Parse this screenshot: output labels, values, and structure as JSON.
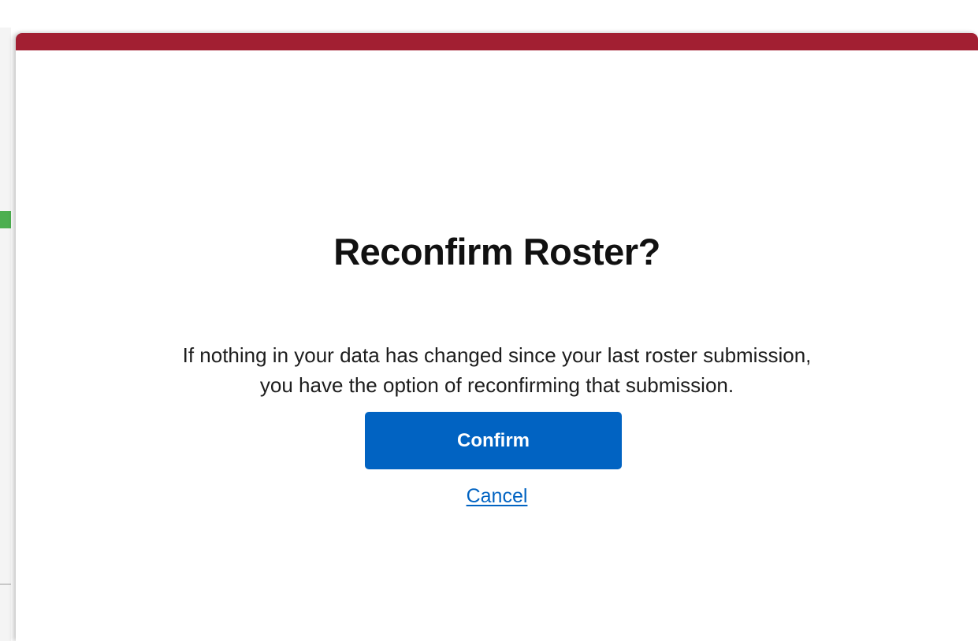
{
  "colors": {
    "modal_top_bar": "#a21f32",
    "primary_button": "#0163c2",
    "link": "#0163c2",
    "background_accent": "#4caf50"
  },
  "dialog": {
    "title": "Reconfirm Roster?",
    "message_lines": [
      "If nothing in your data has changed since your last roster submission,",
      "you have the option of reconfirming that submission."
    ],
    "confirm_label": "Confirm",
    "cancel_label": "Cancel"
  }
}
